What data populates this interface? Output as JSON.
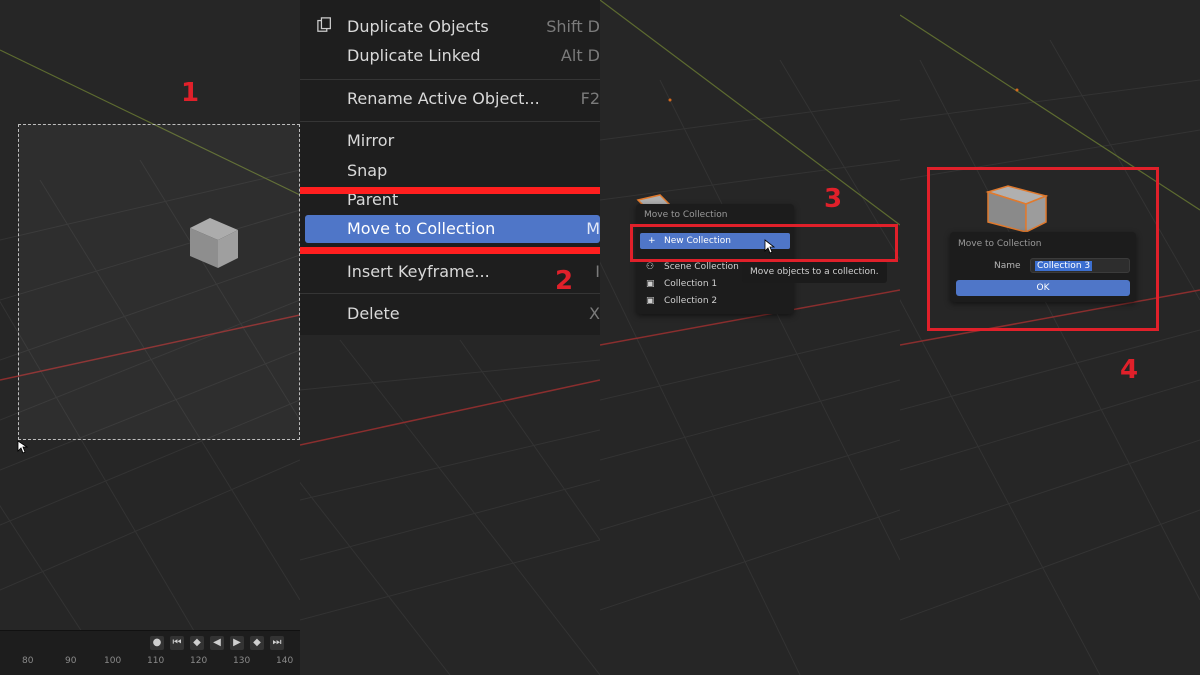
{
  "steps": {
    "s1": "1",
    "s2": "2",
    "s3": "3",
    "s4": "4"
  },
  "colors": {
    "accent": "#4f76c8",
    "annotation_red": "#e0202a",
    "menu_bg": "#1e1e1e",
    "viewport_bg": "#262626"
  },
  "timeline": {
    "ticks": [
      "80",
      "90",
      "100",
      "110",
      "120",
      "130",
      "140"
    ],
    "controls": [
      "keyframe-dot-icon",
      "jump-start-icon",
      "prev-keyframe-icon",
      "play-reverse-icon",
      "play-icon",
      "next-keyframe-icon",
      "jump-end-icon"
    ]
  },
  "context_menu": {
    "items": [
      {
        "label": "Duplicate Objects",
        "shortcut": "Shift D"
      },
      {
        "label": "Duplicate Linked",
        "shortcut": "Alt D"
      },
      {
        "label": "Rename Active Object...",
        "shortcut": "F2"
      },
      {
        "label": "Mirror",
        "shortcut": ""
      },
      {
        "label": "Snap",
        "shortcut": ""
      },
      {
        "label": "Parent",
        "shortcut": ""
      },
      {
        "label": "Move to Collection",
        "shortcut": "M"
      },
      {
        "label": "Insert Keyframe...",
        "shortcut": "I"
      },
      {
        "label": "Delete",
        "shortcut": "X"
      }
    ]
  },
  "move_popup": {
    "title": "Move to Collection",
    "new_collection": "New Collection",
    "items": [
      "Scene Collection",
      "Collection 1",
      "Collection 2"
    ],
    "tooltip": "Move objects to a collection."
  },
  "name_dialog": {
    "title": "Move to Collection",
    "name_label": "Name",
    "name_value": "Collection 3",
    "ok_label": "OK"
  }
}
